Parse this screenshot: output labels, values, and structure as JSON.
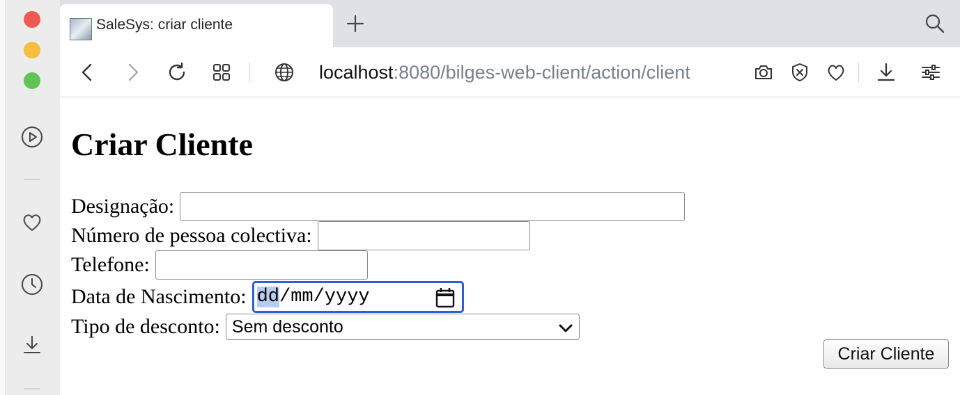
{
  "window": {
    "traffic_lights": {
      "close": "#ee5a52",
      "minimize": "#f5be3f",
      "zoom": "#5fc454"
    }
  },
  "sidebar": {
    "icons": [
      "play-icon",
      "heart-icon",
      "clock-icon",
      "download-icon"
    ]
  },
  "tab": {
    "title": "SaleSys: criar cliente",
    "favicon": "app-favicon-icon"
  },
  "toolbar": {
    "url_host": "localhost",
    "url_rest": ":8080/bilges-web-client/action/client",
    "icons": [
      "back-icon",
      "forward-icon",
      "reload-icon",
      "grid-icon",
      "globe-icon",
      "camera-icon",
      "shield-icon",
      "heart-icon",
      "download-icon",
      "settings-icon"
    ]
  },
  "form": {
    "heading": "Criar Cliente",
    "designacao_label": "Designação:",
    "designacao_value": "",
    "nif_label": "Número de pessoa colectiva:",
    "nif_value": "",
    "telefone_label": "Telefone:",
    "telefone_value": "",
    "data_label": "Data de Nascimento:",
    "date_dd": "dd",
    "date_sep1": "/",
    "date_mm": "mm",
    "date_sep2": "/",
    "date_yyyy": "yyyy",
    "desconto_label": "Tipo de desconto:",
    "desconto_value": "Sem desconto",
    "submit_label": "Criar Cliente"
  },
  "colors": {
    "accent": "#2a5fd6",
    "tabbar_bg": "#dfe1e7",
    "sidebar_bg": "#ececec",
    "url_dim": "#76808c"
  }
}
